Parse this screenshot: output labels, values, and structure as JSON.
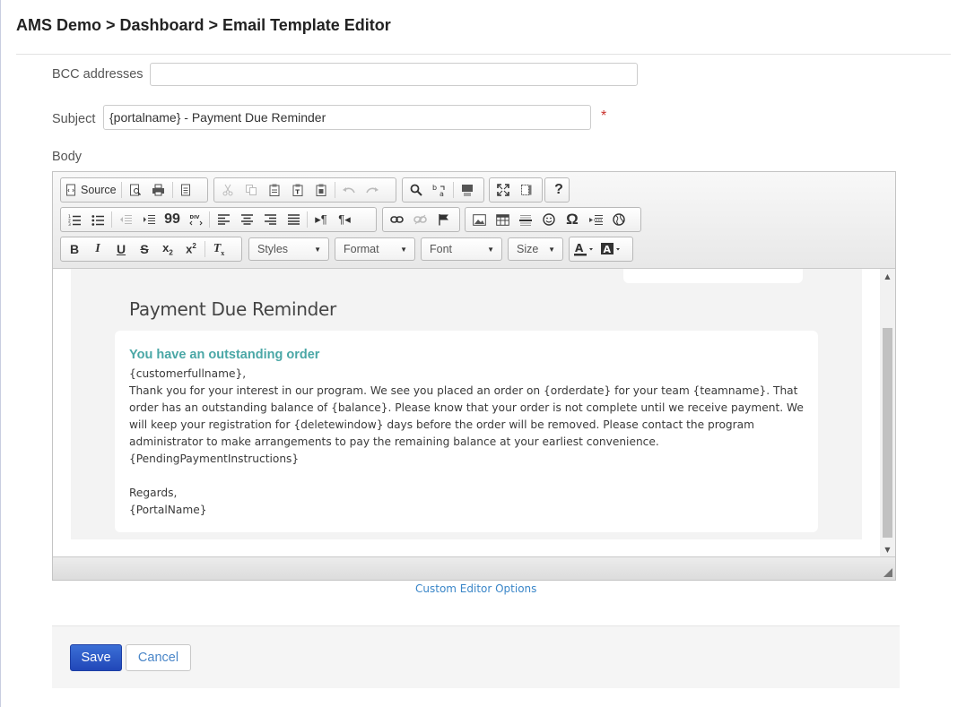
{
  "breadcrumb": "AMS Demo > Dashboard > Email Template Editor",
  "bcc": {
    "label": "BCC addresses",
    "value": ""
  },
  "subject": {
    "label": "Subject",
    "value": "{portalname} - Payment Due Reminder",
    "required_mark": "*"
  },
  "body_label": "Body",
  "toolbar": {
    "source_label": "Source",
    "styles_label": "Styles",
    "format_label": "Format",
    "font_label": "Font",
    "size_label": "Size"
  },
  "email": {
    "heading": "Payment Due Reminder",
    "card_title": "You have an outstanding order",
    "greeting": "{customerfullname},",
    "paragraph": "Thank you for your interest in our program. We see you placed an order on {orderdate} for your team {teamname}. That order has an outstanding balance of {balance}. Please know that your order is not complete until we receive payment. We will keep your registration for {deletewindow} days before the order will be removed. Please contact the program administrator to make arrangements to pay the remaining balance at your earliest convenience.",
    "instructions": "{PendingPaymentInstructions}",
    "regards": "Regards,",
    "signature": "{PortalName}"
  },
  "custom_options_link": "Custom Editor Options",
  "buttons": {
    "save": "Save",
    "cancel": "Cancel"
  },
  "colors": {
    "accent_teal": "#4aa7a6",
    "save_blue": "#2b55c6",
    "link_blue": "#3a86c8",
    "required_red": "#c9302c"
  }
}
